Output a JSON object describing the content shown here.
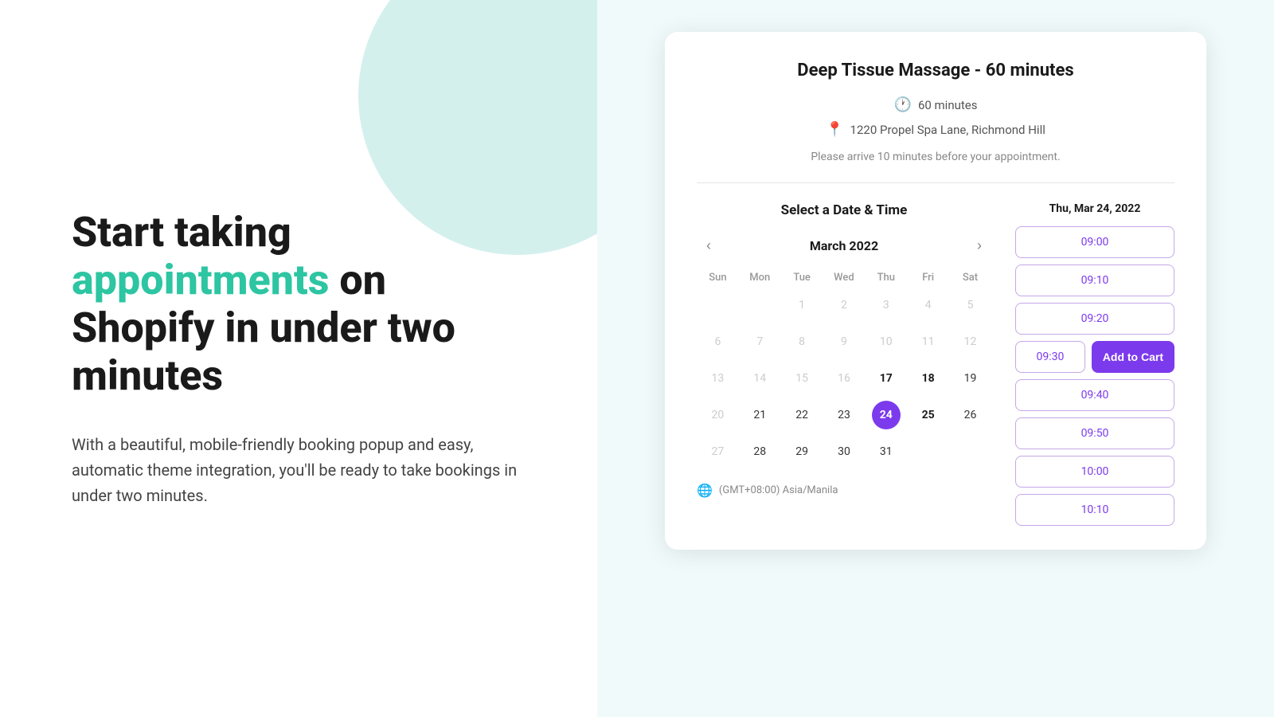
{
  "left": {
    "title_part1": "Start taking ",
    "title_accent": "appointments",
    "title_part2": " on Shopify in under two minutes",
    "subtitle": "With a beautiful, mobile-friendly booking popup and easy, automatic theme integration, you'll be ready to take bookings in under two minutes."
  },
  "card": {
    "service_title": "Deep Tissue Massage - 60 minutes",
    "duration": "60 minutes",
    "location": "1220 Propel Spa Lane, Richmond Hill",
    "arrival_note": "Please arrive 10 minutes before your appointment.",
    "section_label": "Select a Date & Time",
    "selected_date_label": "Thu, Mar 24, 2022",
    "calendar": {
      "month_label": "March 2022",
      "prev_label": "‹",
      "next_label": "›",
      "day_headers": [
        "Sun",
        "Mon",
        "Tue",
        "Wed",
        "Thu",
        "Fri",
        "Sat"
      ],
      "weeks": [
        [
          null,
          null,
          "1",
          "2",
          "3",
          "4",
          "5"
        ],
        [
          "6",
          "7",
          "8",
          "9",
          "10",
          "11",
          "12"
        ],
        [
          "13",
          "14",
          "15",
          "16",
          "17",
          "18",
          "19"
        ],
        [
          "20",
          "21",
          "22",
          "23",
          "24",
          "25",
          "26"
        ],
        [
          "27",
          "28",
          "29",
          "30",
          "31",
          null,
          null
        ]
      ],
      "selected_day": "24",
      "bold_days": [
        "17",
        "18",
        "24",
        "25"
      ],
      "inactive_days": [
        "1",
        "2",
        "3",
        "4",
        "5",
        "6",
        "7",
        "8",
        "9",
        "10",
        "11",
        "12",
        "13",
        "14",
        "15",
        "16",
        "20",
        "27"
      ]
    },
    "timezone": "(GMT+08:00) Asia/Manila",
    "time_slots": [
      {
        "time": "09:00",
        "type": "single"
      },
      {
        "time": "09:10",
        "type": "single"
      },
      {
        "time": "09:20",
        "type": "single"
      },
      {
        "time": "09:30",
        "type": "with_cart",
        "cart_label": "Add to Cart"
      },
      {
        "time": "09:40",
        "type": "single"
      },
      {
        "time": "09:50",
        "type": "single"
      },
      {
        "time": "10:00",
        "type": "single"
      },
      {
        "time": "10:10",
        "type": "single"
      }
    ]
  }
}
